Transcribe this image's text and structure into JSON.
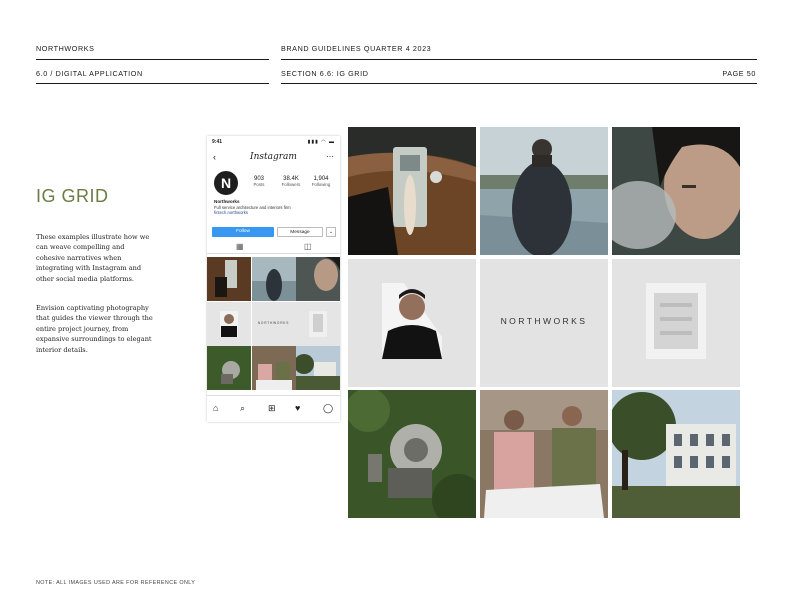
{
  "header": {
    "brand": "NORTHWORKS",
    "doc_title": "BRAND GUIDELINES QUARTER 4 2023",
    "chapter": "6.0 / DIGITAL APPLICATION",
    "section": "SECTION 6.6: IG GRID",
    "page": "PAGE 50"
  },
  "content": {
    "title": "IG GRID",
    "paragraph_1": "These examples illustrate how we can weave compelling and cohesive narratives when integrating with Instagram and other social media platforms.",
    "paragraph_2": "Envision captivating photography that guides the viewer through the entire project journey, from expansive surroundings to elegant interior details."
  },
  "phone": {
    "time": "9:41",
    "signal": "▮▮▮ ◠ ▬",
    "back_icon": "chevron-left-icon",
    "app_name": "Instagram",
    "more_icon": "more-icon",
    "avatar_letter": "N",
    "stats": [
      {
        "value": "903",
        "label": "Posts"
      },
      {
        "value": "38.4K",
        "label": "Followers"
      },
      {
        "value": "1,904",
        "label": "Following"
      }
    ],
    "profile_name": "Northworks",
    "bio": "Full service architecture and interiors firm",
    "link": "fintech.northworks",
    "follow_label": "Follow",
    "message_label": "Message",
    "dropdown_glyph": "⌄",
    "grid_tab_glyph": "▦",
    "tagged_tab_glyph": "◫",
    "nav_glyphs": [
      "⌂",
      "⌕",
      "⊞",
      "♥",
      "◯"
    ],
    "grid_brand_word": "NORTHWORKS"
  },
  "grid": {
    "brand_word": "NORTHWORKS"
  },
  "footnote": "NOTE: ALL IMAGES USED ARE FOR REFERENCE ONLY",
  "colors": {
    "accent": "#6b7d45",
    "follow_blue": "#3897f0"
  }
}
